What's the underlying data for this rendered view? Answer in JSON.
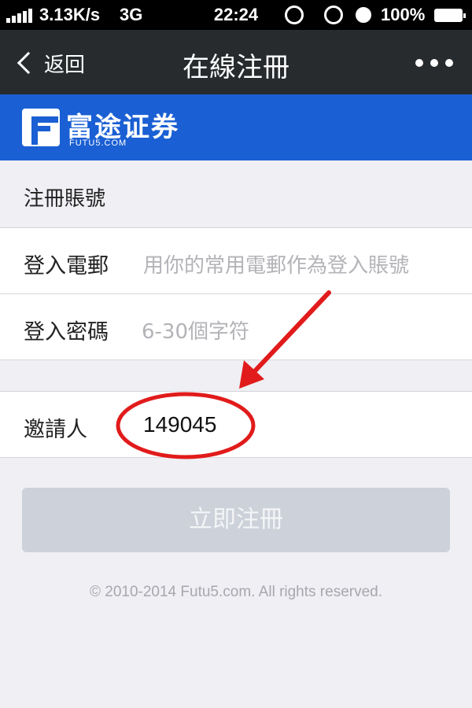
{
  "status_bar": {
    "speed": "3.13K/s",
    "network": "3G",
    "time": "22:24",
    "battery_percent": "100%",
    "icons": [
      "signal-icon",
      "sync-icon",
      "rotation-lock-icon",
      "alarm-icon",
      "battery-icon"
    ]
  },
  "nav": {
    "back_label": "返回",
    "title": "在線注冊",
    "more_icon": "more-icon"
  },
  "brand": {
    "name": "富途证券",
    "domain": "FUTU5.COM",
    "color": "#1a5fd3"
  },
  "form": {
    "section_title": "注冊賬號",
    "email": {
      "label": "登入電郵",
      "placeholder": "用你的常用電郵作為登入賬號"
    },
    "password": {
      "label": "登入密碼",
      "placeholder": "6-30個字符"
    },
    "inviter": {
      "label": "邀請人",
      "value": "149045"
    },
    "submit_label": "立即注冊"
  },
  "footer": {
    "copyright": "© 2010-2014 Futu5.com. All rights reserved."
  },
  "annotation": {
    "color": "#e11b1b",
    "shapes": [
      "arrow",
      "ellipse"
    ]
  }
}
